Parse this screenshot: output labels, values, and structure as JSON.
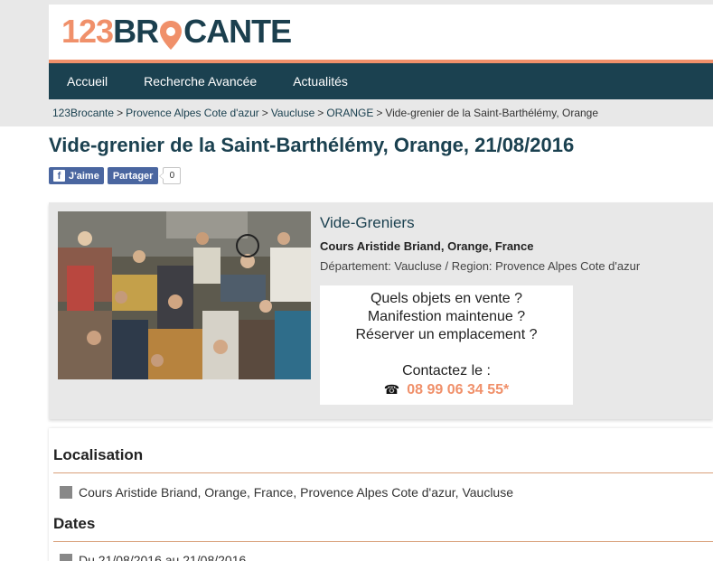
{
  "logo": {
    "number": "123",
    "brand_start": "BR",
    "brand_end": "CANTE"
  },
  "nav": [
    "Accueil",
    "Recherche Avancée",
    "Actualités"
  ],
  "breadcrumb": [
    "123Brocante",
    "Provence Alpes Cote d'azur",
    "Vaucluse",
    "ORANGE",
    "Vide-grenier de la Saint-Barthélémy, Orange"
  ],
  "breadcrumb_sep": ">",
  "title": "Vide-grenier de la Saint-Barthélémy, Orange, 21/08/2016",
  "social": {
    "like_label": "J'aime",
    "share_label": "Partager",
    "count": "0",
    "fb_letter": "f"
  },
  "event": {
    "category": "Vide-Greniers",
    "address": "Cours Aristide Briand, Orange, France",
    "department": "Département: Vaucluse / Region: Provence Alpes Cote d'azur"
  },
  "promo": {
    "line1": "Quels objets en vente ?",
    "line2": "Manifestion maintenue ?",
    "line3": "Réserver un emplacement ?",
    "contact": "Contactez le :",
    "phone": "08 99 06 34 55*"
  },
  "sections": {
    "location_title": "Localisation",
    "location_text": "Cours Aristide Briand, Orange, France, Provence Alpes Cote d'azur, Vaucluse",
    "dates_title": "Dates",
    "dates_text": "Du 21/08/2016 au 21/08/2016"
  },
  "colors": {
    "accent": "#f0906a",
    "navy": "#1b4150",
    "facebook": "#4a66a0"
  }
}
